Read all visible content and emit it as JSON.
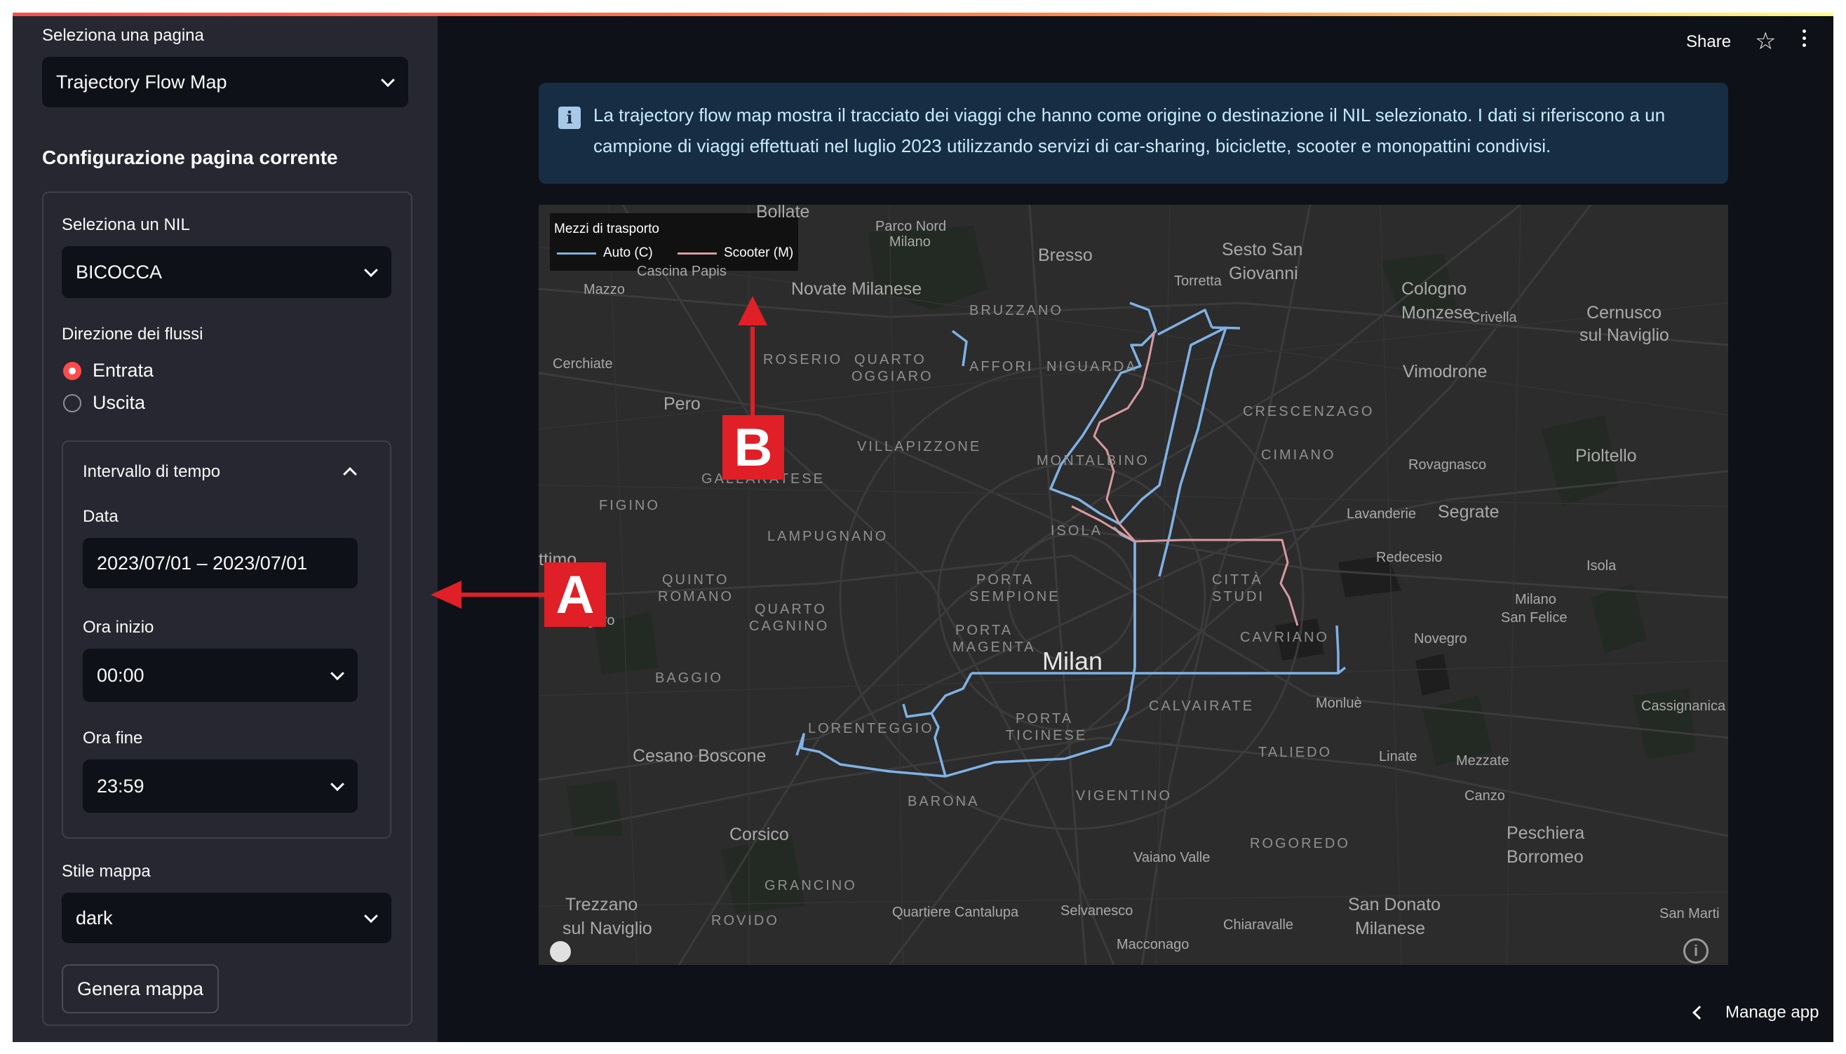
{
  "sidebar": {
    "page_select_label": "Seleziona una pagina",
    "page_select_value": "Trajectory Flow Map",
    "config_heading": "Configurazione pagina corrente",
    "nil_label": "Seleziona un NIL",
    "nil_value": "BICOCCA",
    "direction_label": "Direzione dei flussi",
    "direction_options": [
      "Entrata",
      "Uscita"
    ],
    "direction_selected": "Entrata",
    "time_expander": {
      "title": "Intervallo di tempo",
      "date_label": "Data",
      "date_value": "2023/07/01 – 2023/07/01",
      "start_label": "Ora inizio",
      "start_value": "00:00",
      "end_label": "Ora fine",
      "end_value": "23:59"
    },
    "map_style_label": "Stile mappa",
    "map_style_value": "dark",
    "generate_button": "Genera mappa"
  },
  "header": {
    "share": "Share"
  },
  "info": {
    "icon": "info-icon",
    "text": "La trajectory flow map mostra il tracciato dei viaggi che hanno come origine o destinazione il NIL selezionato. I dati si riferiscono a un campione di viaggi effettuati nel luglio 2023 utilizzando servizi di car-sharing, biciclette, scooter e monopattini condivisi."
  },
  "map": {
    "legend_title": "Mezzi di trasporto",
    "legend_items": [
      {
        "label": "Auto (C)",
        "color": "#7fb2e5"
      },
      {
        "label": "Scooter (M)",
        "color": "#d89aa0"
      }
    ],
    "places": {
      "bollate": "Bollate",
      "parco_nord": "Parco Nord",
      "milano_small": "Milano",
      "bresso": "Bresso",
      "sesto": "Sesto San",
      "giovanni": "Giovanni",
      "torretta": "Torretta",
      "cologno": "Cologno",
      "monzese": "Monzese",
      "crivella": "Crivella",
      "cernusco": "Cernusco",
      "naviglio_c": "sul Naviglio",
      "mazzo": "Mazzo",
      "cascina": "Cascina Papis",
      "novate": "Novate Milanese",
      "bruzzano": "BRUZZANO",
      "cerchiate": "Cerchiate",
      "roserio": "ROSERIO",
      "quarto_o1": "QUARTO",
      "quarto_o2": "OGGIARO",
      "affori": "AFFORI",
      "niguarda": "NIGUARDA",
      "vimodrone": "Vimodrone",
      "pero": "Pero",
      "crescenzago": "CRESCENZAGO",
      "villapizzone": "VILLAPIZZONE",
      "montalbino": "MONTALBINO",
      "cimiano": "CIMIANO",
      "rovagnasco": "Rovagnasco",
      "pioltello": "Pioltello",
      "gallaratese": "GALLARATESE",
      "figino": "FIGINO",
      "isola": "ISOLA",
      "lavanderie": "Lavanderie",
      "segrate": "Segrate",
      "lampugnano": "LAMPUGNANO",
      "redecesio": "Redecesio",
      "isola_r": "Isola",
      "settimo": "ttimo",
      "quinto1": "QUINTO",
      "quinto2": "ROMANO",
      "porta_semp1": "PORTA",
      "porta_semp2": "SEMPIONE",
      "citta1": "CITTÀ",
      "citta2": "STUDI",
      "milano_sf1": "Milano",
      "milano_sf2": "San Felice",
      "seguro": "Seguro",
      "quarto_c1": "QUARTO",
      "quarto_c2": "CAGNINO",
      "porta_mag1": "PORTA",
      "porta_mag2": "MAGENTA",
      "cavriano": "CAVRIANO",
      "novegro": "Novegro",
      "milan": "Milan",
      "baggio": "BAGGIO",
      "calvairate": "CALVAIRATE",
      "monlue": "Monluè",
      "cassignanica": "Cassignanica",
      "porta_tic1": "PORTA",
      "porta_tic2": "TICINESE",
      "lorenteggio": "LORENTEGGIO",
      "taliedo": "TALIEDO",
      "linate": "Linate",
      "mezzate": "Mezzate",
      "cesano": "Cesano Boscone",
      "barona": "BARONA",
      "vigentino": "VIGENTINO",
      "canzo": "Canzo",
      "corsico": "Corsico",
      "rogoredo": "ROGOREDO",
      "peschiera": "Peschiera",
      "borromeo": "Borromeo",
      "vaiano": "Vaiano Valle",
      "grancino": "GRANCINO",
      "trezzano": "Trezzano",
      "naviglio_t": "sul Naviglio",
      "rovido": "ROVIDO",
      "cantalupa": "Quartiere Cantalupa",
      "selvanesco": "Selvanesco",
      "chiaravalle": "Chiaravalle",
      "sandonato": "San Donato",
      "milanese": "Milanese",
      "macconago": "Macconago",
      "sanmartino": "San Marti"
    }
  },
  "annotations": {
    "a": "A",
    "b": "B"
  },
  "footer": {
    "manage_app": "Manage app"
  }
}
